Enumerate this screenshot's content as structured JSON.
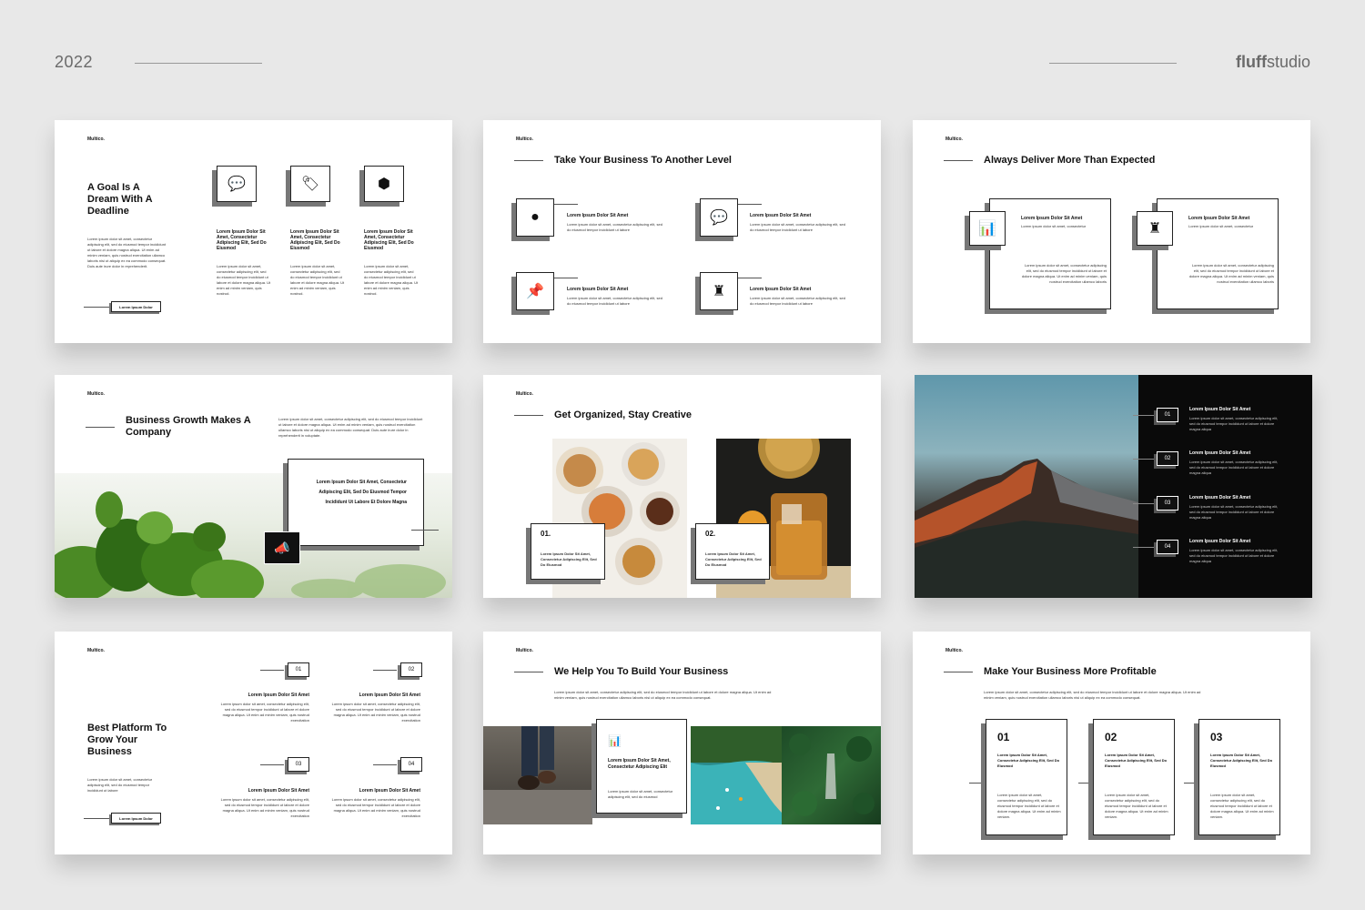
{
  "header": {
    "year": "2022",
    "brand_bold": "fluff",
    "brand_rest": "studio"
  },
  "logo": "Multico.",
  "slide1": {
    "title": "A Goal Is A Dream With A Deadline",
    "body": "Lorem ipsum dolor sit amet, consectetur adipiscing elit, sed do eiusmod tempor incididunt ut labore et dolore magna aliqua. Ut enim ad minim veniam, quis nostrud exercitation ullamco laboris nisi ut aliquip ex ea commodo consequat. Duis aute irure dolor in reprehenderit.",
    "button": "Lorem Ipsum Dolor",
    "items": [
      {
        "icon": "chat-icon",
        "glyph": "💬",
        "heading": "Lorem Ipsum Dolor Sit Amet, Consectetur Adipiscing Elit, Sed Do Eiusmod",
        "body": "Lorem ipsum dolor sit amet, consectetur adipiscing elit, sed do eiusmod tempor incididunt ut labore et dolore magna aliqua. Ut enim ad minim veniam, quis nostrud."
      },
      {
        "icon": "tag-icon",
        "glyph": "🏷",
        "heading": "Lorem Ipsum Dolor Sit Amet, Consectetur Adipiscing Elit, Sed Do Eiusmod",
        "body": "Lorem ipsum dolor sit amet, consectetur adipiscing elit, sed do eiusmod tempor incididunt ut labore et dolore magna aliqua. Ut enim ad minim veniam, quis nostrud."
      },
      {
        "icon": "cube-icon",
        "glyph": "⬢",
        "heading": "Lorem Ipsum Dolor Sit Amet, Consectetur Adipiscing Elit, Sed Do Eiusmod",
        "body": "Lorem ipsum dolor sit amet, consectetur adipiscing elit, sed do eiusmod tempor incididunt ut labore et dolore magna aliqua. Ut enim ad minim veniam, quis nostrud."
      }
    ]
  },
  "slide2": {
    "title": "Take Your Business To Another Level",
    "items": [
      {
        "icon": "globe-icon",
        "glyph": "●",
        "heading": "Lorem Ipsum Dolor Sit Amet",
        "body": "Lorem ipsum dolor sit amet, consectetur adipiscing elit, sed do eiusmod tempor incididunt ut labore"
      },
      {
        "icon": "chat-icon",
        "glyph": "💬",
        "heading": "Lorem Ipsum Dolor Sit Amet",
        "body": "Lorem ipsum dolor sit amet, consectetur adipiscing elit, sed do eiusmod tempor incididunt ut labore"
      },
      {
        "icon": "pin-icon",
        "glyph": "📌",
        "heading": "Lorem Ipsum Dolor Sit Amet",
        "body": "Lorem ipsum dolor sit amet, consectetur adipiscing elit, sed do eiusmod tempor incididunt ut labore"
      },
      {
        "icon": "chess-icon",
        "glyph": "♜",
        "heading": "Lorem Ipsum Dolor Sit Amet",
        "body": "Lorem ipsum dolor sit amet, consectetur adipiscing elit, sed do eiusmod tempor incididunt ut labore"
      }
    ]
  },
  "slide3": {
    "title": "Always Deliver More Than Expected",
    "cards": [
      {
        "icon": "bar-chart-icon",
        "glyph": "▮▮▮",
        "heading": "Lorem Ipsum Dolor Sit Amet",
        "sub": "Lorem ipsum dolor sit amet, consectetur",
        "body": "Lorem ipsum dolor sit amet, consectetur adipiscing elit, sed do eiusmod tempor incididunt ut labore et dolore magna aliqua. Ut enim ad minim veniam, quis nostrud exercitation ullamco laboris"
      },
      {
        "icon": "chess-icon",
        "glyph": "♜",
        "heading": "Lorem Ipsum Dolor Sit Amet",
        "sub": "Lorem ipsum dolor sit amet, consectetur",
        "body": "Lorem ipsum dolor sit amet, consectetur adipiscing elit, sed do eiusmod tempor incididunt ut labore et dolore magna aliqua. Ut enim ad minim veniam, quis nostrud exercitation ullamco laboris"
      }
    ]
  },
  "slide4": {
    "title": "Business Growth Makes A Company",
    "intro": "Lorem ipsum dolor sit amet, consectetur adipiscing elit, sed do eiusmod tempor incididunt ut labore et dolore magna aliqua. Ut enim ad minim veniam, quis nostrud exercitation ullamco laboris nisi ut aliquip ex ea commodo consequat. Duis aute irure dolor in reprehenderit in voluptate.",
    "card": "Lorem Ipsum Dolor Sit Amet, Consectetur Adipiscing Elit, Sed Do Eiusmod Tempor Incididunt Ut Labore Et Dolore Magna"
  },
  "slide5": {
    "title": "Get Organized, Stay Creative",
    "cards": [
      {
        "num": "01.",
        "body": "Lorem Ipsum Dolor Sit Amet, Consectetur Adipiscing Elit, Sed Do Eiusmod"
      },
      {
        "num": "02.",
        "body": "Lorem Ipsum Dolor Sit Amet, Consectetur Adipiscing Elit, Sed Do Eiusmod"
      }
    ]
  },
  "slide6": {
    "items": [
      {
        "num": "01",
        "heading": "Lorem Ipsum Dolor Sit Amet",
        "body": "Lorem ipsum dolor sit amet, consectetur adipiscing elit, sed do eiusmod tempor incididunt ut labore et dolore magna aliqua"
      },
      {
        "num": "02",
        "heading": "Lorem Ipsum Dolor Sit Amet",
        "body": "Lorem ipsum dolor sit amet, consectetur adipiscing elit, sed do eiusmod tempor incididunt ut labore et dolore magna aliqua"
      },
      {
        "num": "03",
        "heading": "Lorem Ipsum Dolor Sit Amet",
        "body": "Lorem ipsum dolor sit amet, consectetur adipiscing elit, sed do eiusmod tempor incididunt ut labore et dolore magna aliqua"
      },
      {
        "num": "04",
        "heading": "Lorem Ipsum Dolor Sit Amet",
        "body": "Lorem ipsum dolor sit amet, consectetur adipiscing elit, sed do eiusmod tempor incididunt ut labore et dolore magna aliqua"
      }
    ]
  },
  "slide7": {
    "title": "Best Platform To Grow Your Business",
    "body": "Lorem ipsum dolor sit amet, consectetur adipiscing elit, sed do eiusmod tempor incididunt ut labore",
    "button": "Lorem Ipsum Dolor",
    "items": [
      {
        "num": "01",
        "heading": "Lorem Ipsum Dolor Sit Amet",
        "body": "Lorem ipsum dolor sit amet, consectetur adipiscing elit, sed do eiusmod tempor incididunt ut labore et dolore magna aliqua. Ut enim ad minim veniam, quis nostrud exercitation"
      },
      {
        "num": "02",
        "heading": "Lorem Ipsum Dolor Sit Amet",
        "body": "Lorem ipsum dolor sit amet, consectetur adipiscing elit, sed do eiusmod tempor incididunt ut labore et dolore magna aliqua. Ut enim ad minim veniam, quis nostrud exercitation"
      },
      {
        "num": "03",
        "heading": "Lorem Ipsum Dolor Sit Amet",
        "body": "Lorem ipsum dolor sit amet, consectetur adipiscing elit, sed do eiusmod tempor incididunt ut labore et dolore magna aliqua. Ut enim ad minim veniam, quis nostrud exercitation"
      },
      {
        "num": "04",
        "heading": "Lorem Ipsum Dolor Sit Amet",
        "body": "Lorem ipsum dolor sit amet, consectetur adipiscing elit, sed do eiusmod tempor incididunt ut labore et dolore magna aliqua. Ut enim ad minim veniam, quis nostrud exercitation"
      }
    ]
  },
  "slide8": {
    "title": "We Help You To Build Your Business",
    "intro": "Lorem ipsum dolor sit amet, consectetur adipiscing elit, sed do eiusmod tempor incididunt ut labore et dolore magna aliqua. Ut enim ad minim veniam, quis nostrud exercitation ullamco laboris nisi ut aliquip ex ea commodo consequat.",
    "card_heading": "Lorem Ipsum Dolor Sit Amet, Consectetur Adipiscing Elit",
    "card_body": "Lorem ipsum dolor sit amet, consectetur adipiscing elit, sed do eiusmod",
    "card_icon": "bar-chart-icon"
  },
  "slide9": {
    "title": "Make Your Business More Profitable",
    "intro": "Lorem ipsum dolor sit amet, consectetur adipiscing elit, sed do eiusmod tempor incididunt ut labore et dolore magna aliqua. Ut enim ad minim veniam, quis nostrud exercitation ullamco laboris nisi ut aliquip ex ea commodo consequat.",
    "cards": [
      {
        "num": "01",
        "heading": "Lorem Ipsum Dolor Sit Amet, Consectetur Adipiscing Elit, Sed Do Eiusmod",
        "body": "Lorem ipsum dolor sit amet, consectetur adipiscing elit, sed do eiusmod tempor incididunt ut labore et dolore magna aliqua. Ut enim ad minim veniam."
      },
      {
        "num": "02",
        "heading": "Lorem Ipsum Dolor Sit Amet, Consectetur Adipiscing Elit, Sed Do Eiusmod",
        "body": "Lorem ipsum dolor sit amet, consectetur adipiscing elit, sed do eiusmod tempor incididunt ut labore et dolore magna aliqua. Ut enim ad minim veniam."
      },
      {
        "num": "03",
        "heading": "Lorem Ipsum Dolor Sit Amet, Consectetur Adipiscing Elit, Sed Do Eiusmod",
        "body": "Lorem ipsum dolor sit amet, consectetur adipiscing elit, sed do eiusmod tempor incididunt ut labore et dolore magna aliqua. Ut enim ad minim veniam."
      }
    ]
  }
}
